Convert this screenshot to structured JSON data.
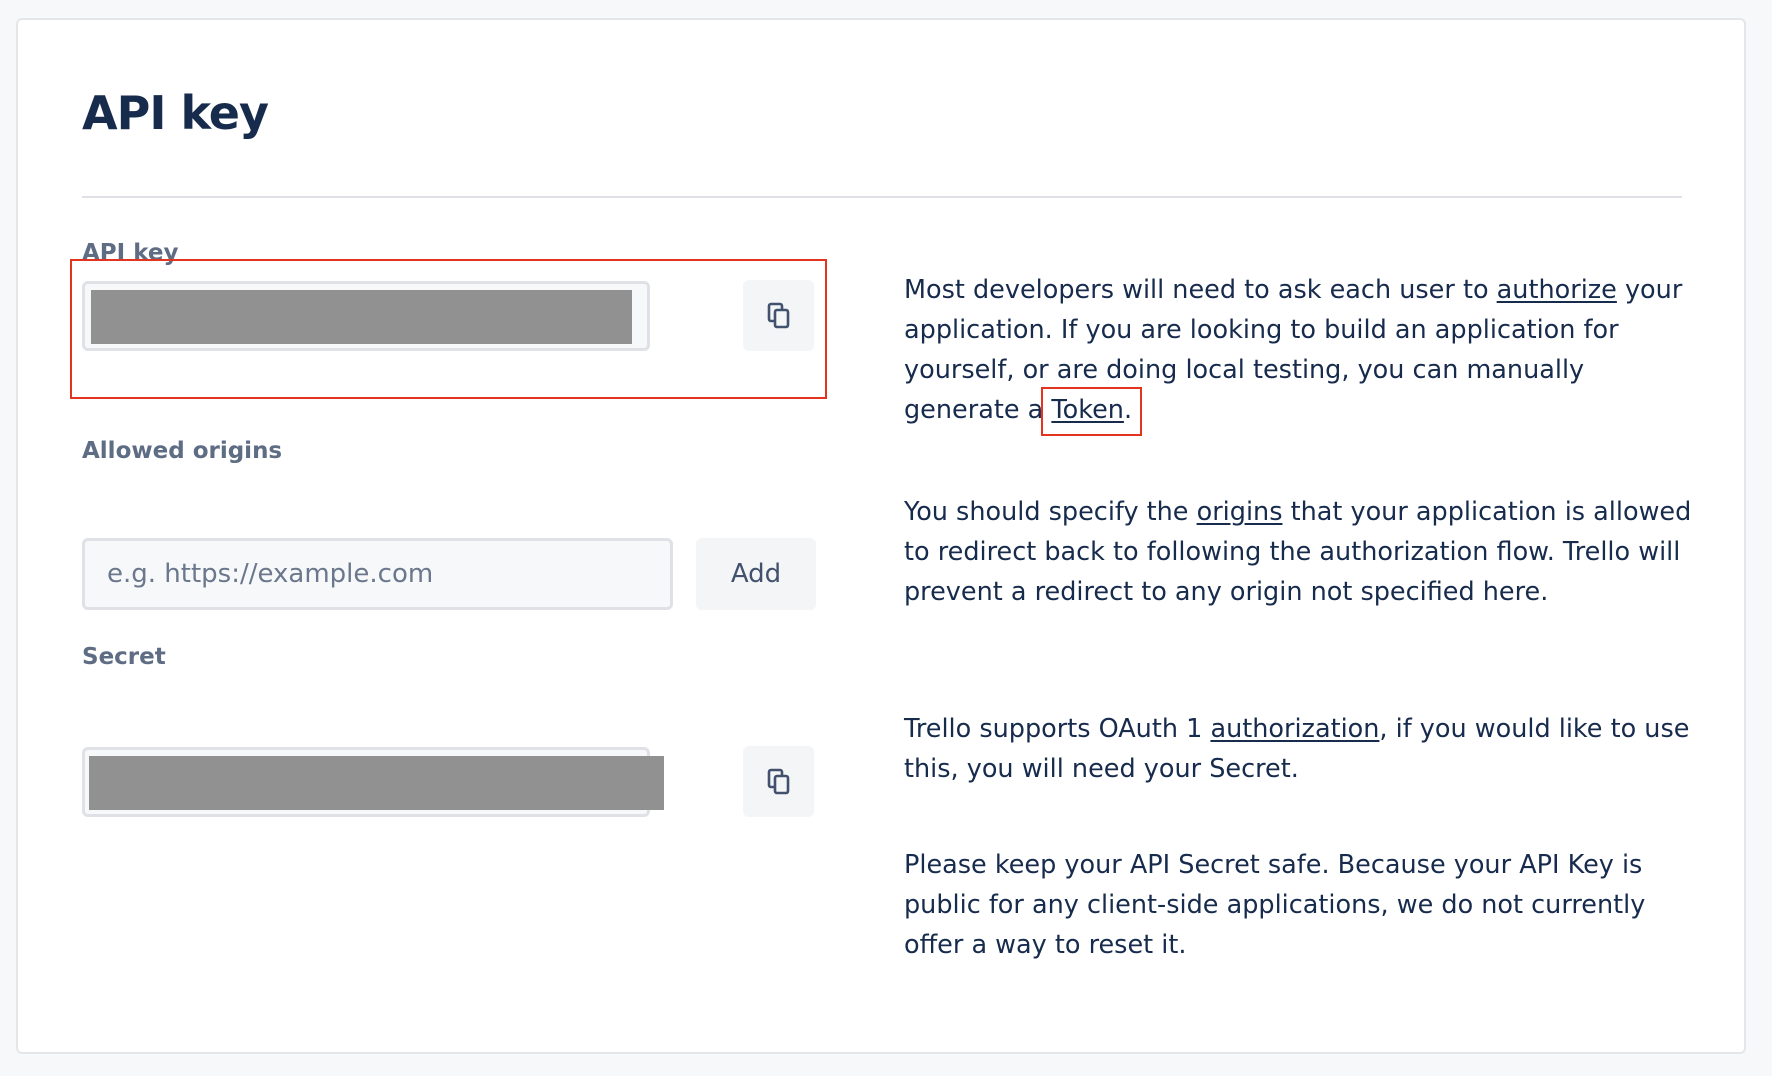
{
  "page": {
    "title": "API key"
  },
  "api_key": {
    "label": "API key",
    "value_hidden": true,
    "copy_icon": "copy-icon"
  },
  "allowed_origins": {
    "label": "Allowed origins",
    "placeholder": "e.g. https://example.com",
    "value": "",
    "add_label": "Add"
  },
  "secret": {
    "label": "Secret",
    "value_hidden": true,
    "copy_icon": "copy-icon"
  },
  "descriptions": {
    "api_key": {
      "t1": "Most developers will need to ask each user to ",
      "link_authorize": "authorize",
      "t2": " your application. If you are looking to build an application for yourself, or are doing local testing, you can manually generate a ",
      "link_token": "Token",
      "t3": "."
    },
    "origins": {
      "t1": "You should specify the ",
      "link_origins": "origins",
      "t2": " that your application is allowed to redirect back to following the authorization flow. Trello will prevent a redirect to any origin not specified here."
    },
    "secret": {
      "t1": "Trello supports OAuth 1 ",
      "link_authorization": "authorization",
      "t2": ", if you would like to use this, you will need your Secret."
    },
    "secret_safety": "Please keep your API Secret safe. Because your API Key is public for any client-side applications, we do not currently offer a way to reset it."
  },
  "colors": {
    "heading": "#172b4d",
    "label": "#5e6c84",
    "redaction": "#919191",
    "highlight": "#e3341f",
    "background": "#f7f8f9"
  }
}
